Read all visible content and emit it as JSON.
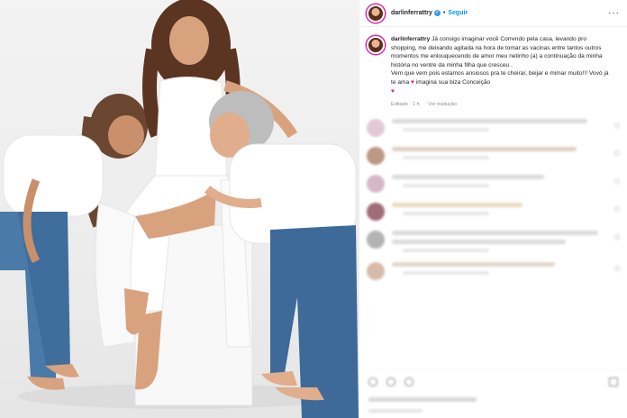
{
  "header": {
    "username": "darlinferrattry",
    "verified_badge": "✔",
    "separator": "•",
    "follow_label": "Seguir",
    "more_label": "···"
  },
  "caption": {
    "username": "darlinferrattry",
    "text_part1": " Já consigo imaginar você Correndo pela casa, levando pro shopping, me deixando agitada na hora de tomar as vacinas entre tantos outros momentos me enlouquecendo de amor meu netinho (a) a continuação da minha história no ventre da minha filha que cresceu .",
    "text_part2": "Vem que vem pois estamos ansiosos pra te cheirar, beijar e mimar muito!!! Vovó já te ama ",
    "text_part3": " imagina sua biza Conceição",
    "heart_glyph": "♥",
    "edited_label": "Editado · 1 h",
    "translate_label": "Ver tradução"
  },
  "colors": {
    "accent": "#0095f6",
    "verified": "#3897f0",
    "heart": "#e0245e",
    "story_ring": "#d6249f"
  },
  "icons": {
    "verified": "verified-badge-icon",
    "heart": "heart-icon",
    "more": "more-options-icon"
  }
}
